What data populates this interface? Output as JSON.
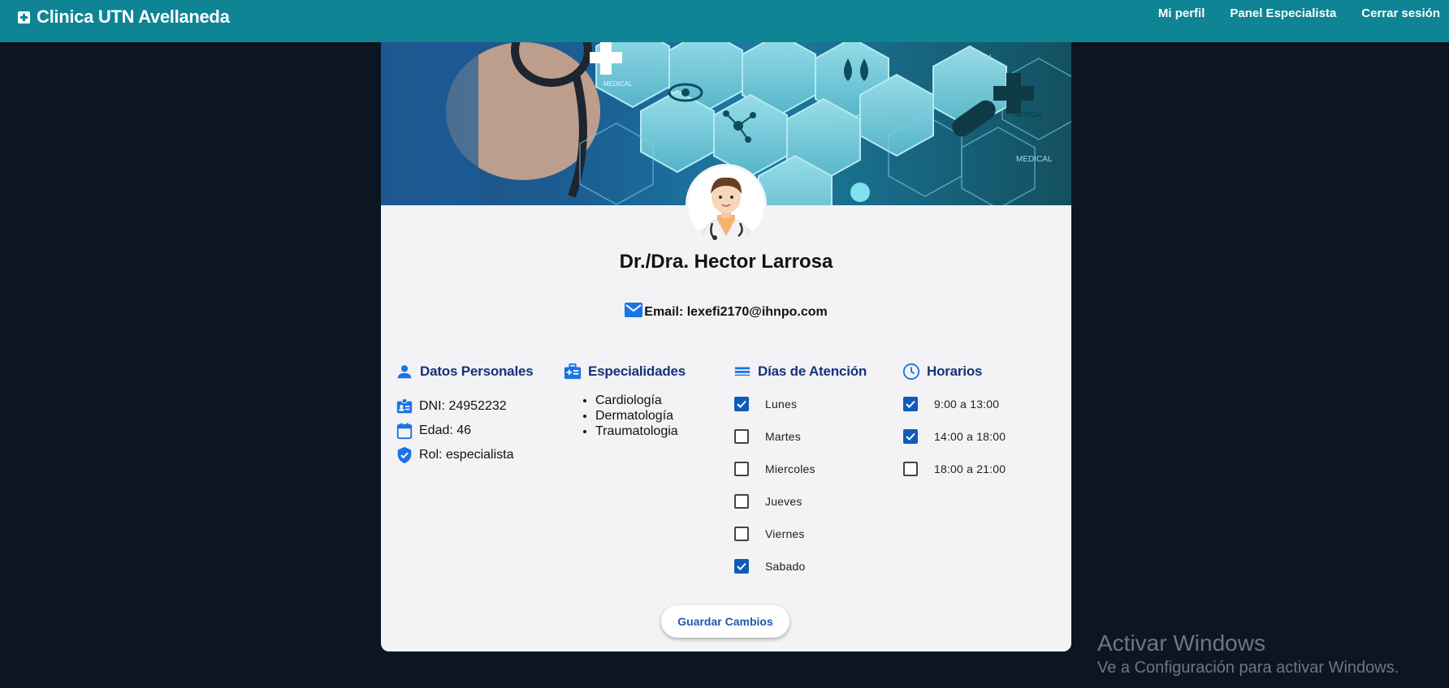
{
  "navbar": {
    "brand": "Clinica UTN Avellaneda",
    "brand_icon": "medical-cross-icon",
    "links": [
      "Mi perfil",
      "Panel Especialista",
      "Cerrar sesión"
    ]
  },
  "banner": {
    "texts": [
      "MEDICAL",
      "MEDICAL",
      "MEDICAL",
      "MEDICAL"
    ]
  },
  "profile": {
    "name": "Dr./Dra. Hector Larrosa",
    "email_label": "Email: lexefi2170@ihnpo.com",
    "email_icon": "mail-icon"
  },
  "personal": {
    "title": "Datos Personales",
    "icon": "person-icon",
    "items": [
      {
        "icon": "id-card-icon",
        "text": "DNI: 24952232"
      },
      {
        "icon": "calendar-icon",
        "text": "Edad: 46"
      },
      {
        "icon": "shield-check-icon",
        "text": "Rol: especialista"
      }
    ]
  },
  "specialties": {
    "title": "Especialidades",
    "icon": "medical-kit-icon",
    "items": [
      "Cardiología",
      "Dermatología",
      "Traumatologia"
    ]
  },
  "days": {
    "title": "Días de Atención",
    "icon": "lines-icon",
    "items": [
      {
        "label": "Lunes",
        "checked": true
      },
      {
        "label": "Martes",
        "checked": false
      },
      {
        "label": "Miercoles",
        "checked": false
      },
      {
        "label": "Jueves",
        "checked": false
      },
      {
        "label": "Viernes",
        "checked": false
      },
      {
        "label": "Sabado",
        "checked": true
      }
    ]
  },
  "hours": {
    "title": "Horarios",
    "icon": "clock-icon",
    "items": [
      {
        "label": "9:00 a 13:00",
        "checked": true
      },
      {
        "label": "14:00 a 18:00",
        "checked": true
      },
      {
        "label": "18:00 a 21:00",
        "checked": false
      }
    ]
  },
  "actions": {
    "save": "Guardar Cambios"
  },
  "watermark": {
    "title": "Activar Windows",
    "subtitle": "Ve a Configuración para activar Windows."
  },
  "colors": {
    "navbar": "#0e8494",
    "background": "#0b1622",
    "card": "#f3f3f5",
    "section_title": "#15337a",
    "icon_blue": "#1a73e8",
    "checkbox": "#0f5bb8"
  }
}
